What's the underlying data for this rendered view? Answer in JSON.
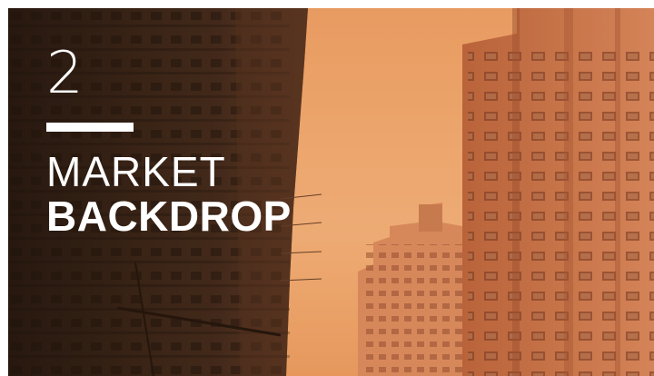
{
  "slide": {
    "chapter_number": "2",
    "title_line_1": "MARKET",
    "title_line_2": "BACKDROP"
  },
  "palette": {
    "sky": "#eaa26b",
    "shadow_buildings": "#2a1a12",
    "lit_buildings": "#c86f46",
    "text": "#ffffff"
  },
  "background": {
    "subject": "city-street-high-rise-photo"
  }
}
